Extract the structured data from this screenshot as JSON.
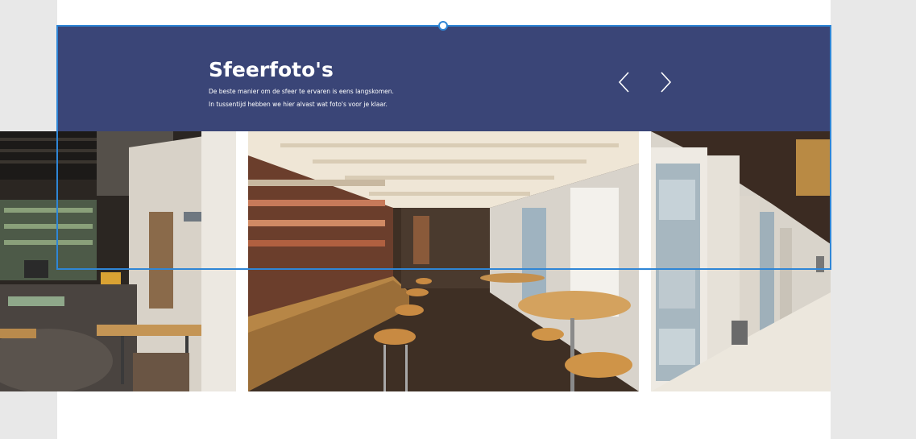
{
  "section": {
    "title": "Sfeerfoto's",
    "subtitle_line1": "De beste manier om de sfeer te ervaren is eens langskomen.",
    "subtitle_line2": "In tussentijd hebben we hier alvast wat foto's voor je klaar."
  },
  "slider": {
    "prev_icon": "chevron-left-icon",
    "next_icon": "chevron-right-icon",
    "slides": [
      {
        "name": "cafe-interior-photo"
      },
      {
        "name": "bar-counter-photo"
      },
      {
        "name": "window-hallway-photo"
      }
    ]
  },
  "colors": {
    "band": "#3a4577",
    "selection": "#2f86d6",
    "page": "#ffffff",
    "canvas": "#e8e8e8"
  }
}
